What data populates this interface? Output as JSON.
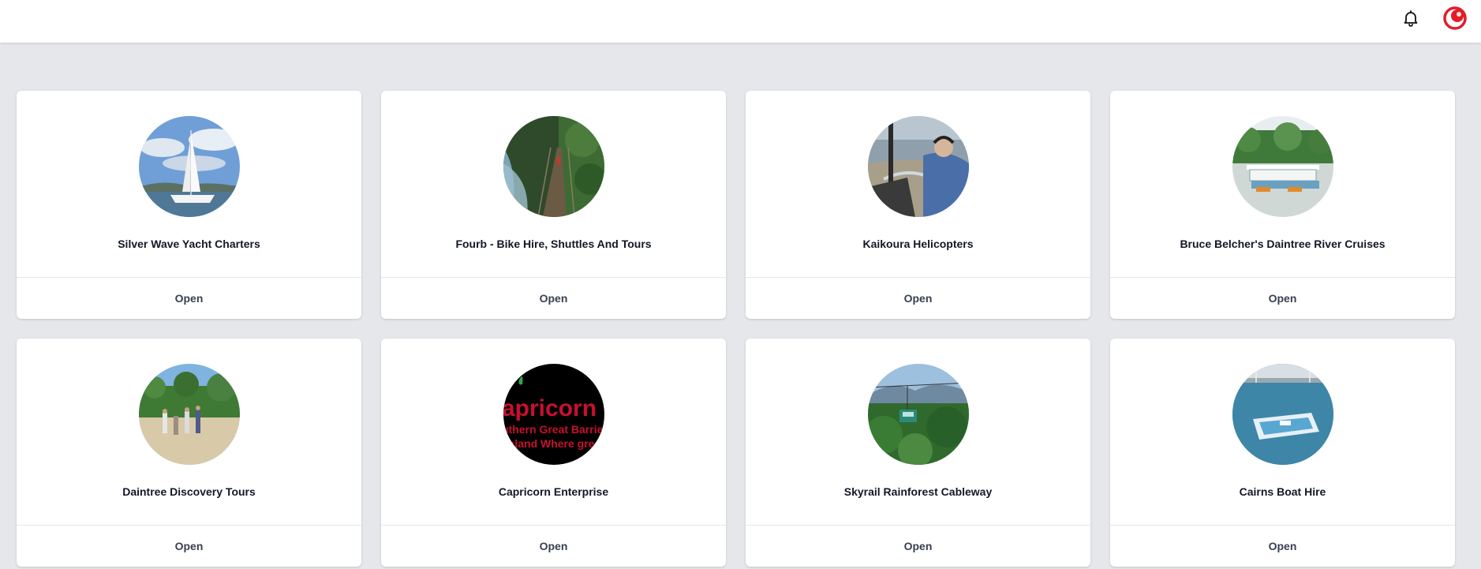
{
  "header": {
    "notifications_icon": "bell-icon",
    "user_icon": "user-avatar-icon",
    "accent_color": "#e11d2a"
  },
  "cards": [
    {
      "title": "Silver Wave Yacht Charters",
      "action": "Open",
      "image": "catamaran-photo"
    },
    {
      "title": "Fourb - Bike Hire, Shuttles And Tours",
      "action": "Open",
      "image": "suspension-bridge-photo"
    },
    {
      "title": "Kaikoura Helicopters",
      "action": "Open",
      "image": "helicopter-cockpit-photo"
    },
    {
      "title": "Bruce Belcher's Daintree River Cruises",
      "action": "Open",
      "image": "river-boat-photo"
    },
    {
      "title": "Daintree Discovery Tours",
      "action": "Open",
      "image": "beach-group-photo"
    },
    {
      "title": "Capricorn Enterprise",
      "action": "Open",
      "image": "capricorn-logo",
      "logo_lines": [
        "apricorn Co",
        "uthern Great Barrier",
        "nsland Where gre"
      ]
    },
    {
      "title": "Skyrail Rainforest Cableway",
      "action": "Open",
      "image": "cableway-photo"
    },
    {
      "title": "Cairns Boat Hire",
      "action": "Open",
      "image": "boat-marina-photo"
    }
  ]
}
